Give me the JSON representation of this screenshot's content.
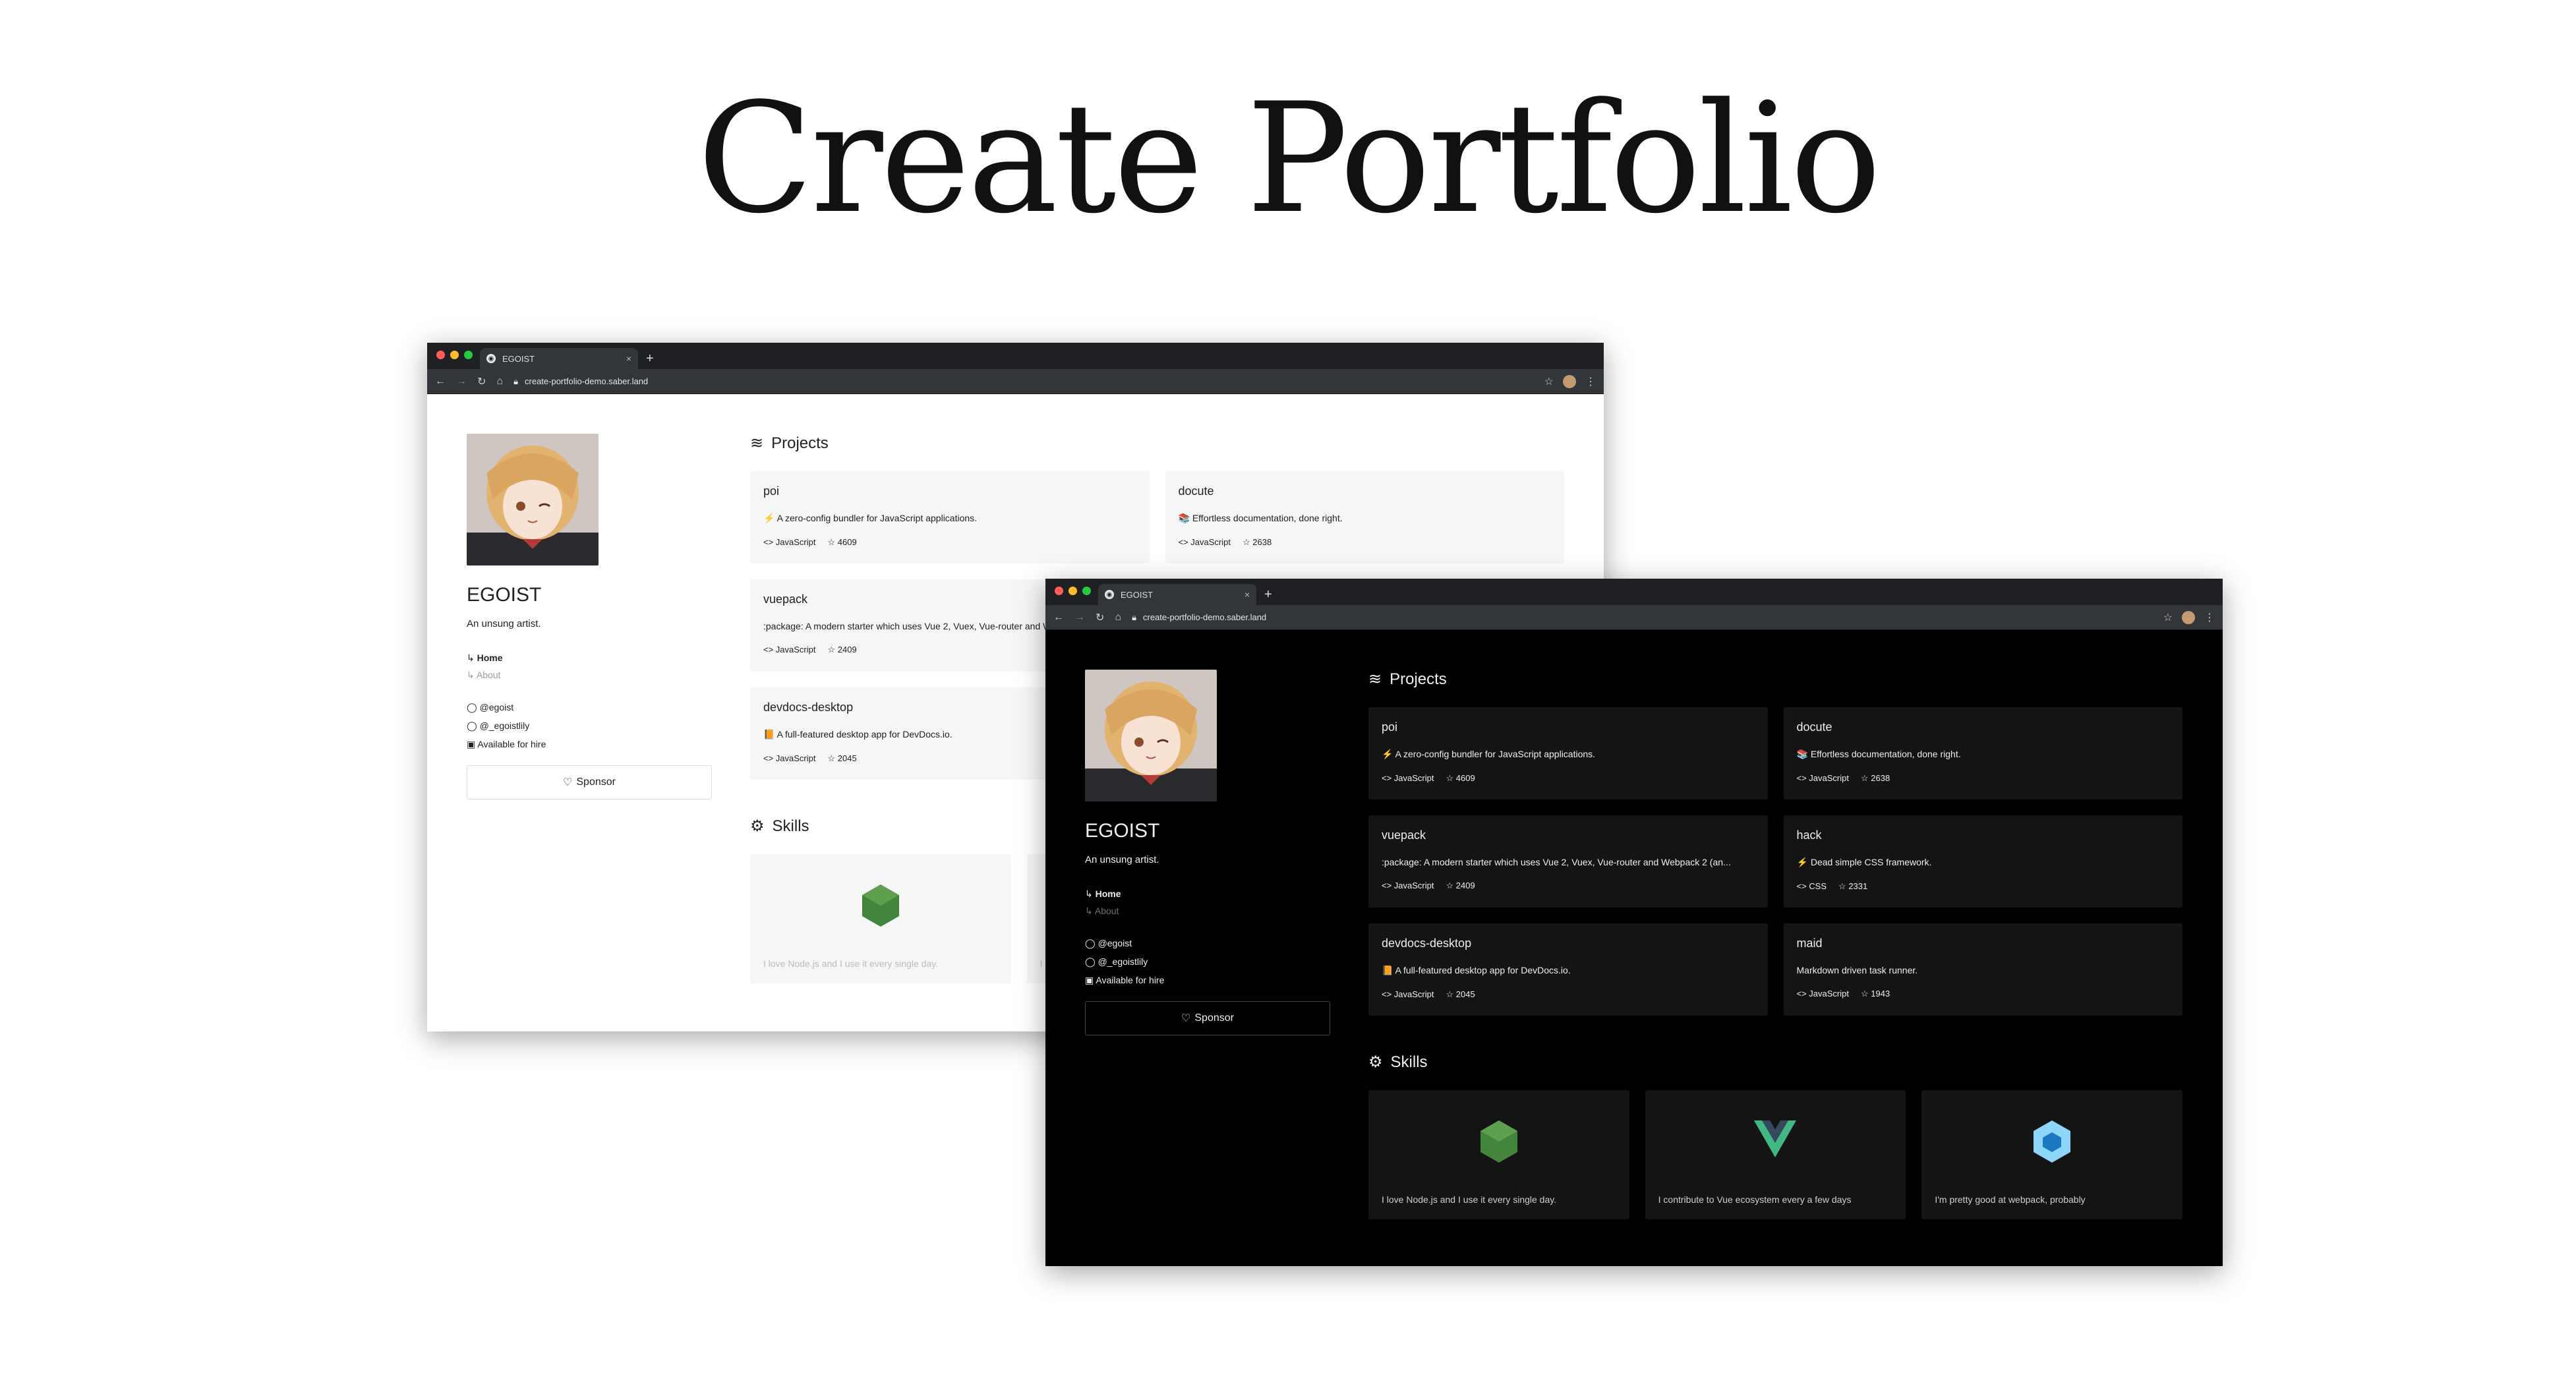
{
  "page": {
    "title": "Create Portfolio"
  },
  "browser": {
    "tab_title": "EGOIST",
    "url": "create-portfolio-demo.saber.land"
  },
  "profile": {
    "name": "EGOIST",
    "bio": "An unsung artist.",
    "nav": {
      "home": "Home",
      "about": "About"
    },
    "social": {
      "github": "@egoist",
      "twitter": "@_egoistlily",
      "hire": "Available for hire"
    },
    "sponsor_label": "Sponsor"
  },
  "sections": {
    "projects": "Projects",
    "skills": "Skills"
  },
  "projects": [
    {
      "name": "poi",
      "emoji": "⚡",
      "description": "A zero-config bundler for JavaScript applications.",
      "language": "JavaScript",
      "stars": "4609"
    },
    {
      "name": "docute",
      "emoji": "📚",
      "description": "Effortless documentation, done right.",
      "language": "JavaScript",
      "stars": "2638"
    },
    {
      "name": "vuepack",
      "emoji": "",
      "description": ":package: A modern starter which uses Vue 2, Vuex, Vue-router and Webpack 2 (an...",
      "language": "JavaScript",
      "stars": "2409"
    },
    {
      "name": "hack",
      "emoji": "⚡",
      "description": "Dead simple CSS framework.",
      "language": "CSS",
      "stars": "2331"
    },
    {
      "name": "devdocs-desktop",
      "emoji": "📙",
      "description": "A full-featured desktop app for DevDocs.io.",
      "language": "JavaScript",
      "stars": "2045"
    },
    {
      "name": "maid",
      "emoji": "",
      "description": "Markdown driven task runner.",
      "language": "JavaScript",
      "stars": "1943"
    }
  ],
  "skills": [
    {
      "logo": "nodejs-logo",
      "description": "I love Node.js and I use it every single day.",
      "color": "#43853d"
    },
    {
      "logo": "vue-logo",
      "description": "I contribute to Vue ecosystem every a few days",
      "color": "#41b883"
    },
    {
      "logo": "webpack-logo",
      "description": "I'm pretty good at webpack, probably",
      "color": "#8dd6f9"
    }
  ],
  "colors": {
    "accent_light": "#ffffff",
    "accent_dark": "#000000"
  }
}
